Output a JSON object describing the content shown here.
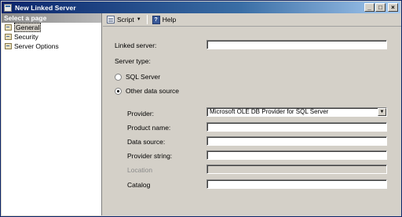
{
  "window": {
    "title": "New Linked Server"
  },
  "title_buttons": {
    "minimize": "_",
    "maximize": "□",
    "close": "×"
  },
  "left_pane": {
    "header": "Select a page",
    "items": [
      {
        "label": "General",
        "icon": "page-wrench-icon",
        "selected": true
      },
      {
        "label": "Security",
        "icon": "page-wrench-icon",
        "selected": false
      },
      {
        "label": "Server Options",
        "icon": "page-wrench-icon",
        "selected": false
      }
    ]
  },
  "toolbar": {
    "script_label": "Script",
    "help_label": "Help",
    "help_glyph": "?"
  },
  "form": {
    "linked_server_label": "Linked server:",
    "linked_server_value": "",
    "server_type_label": "Server type:",
    "sql_server_label": "SQL Server",
    "other_source_label": "Other data source",
    "selected_server_type": "Other data source",
    "provider_label": "Provider:",
    "provider_value": "Microsoft OLE DB Provider for SQL Server",
    "product_name_label": "Product name:",
    "product_name_value": "",
    "data_source_label": "Data source:",
    "data_source_value": "",
    "provider_string_label": "Provider string:",
    "provider_string_value": "",
    "location_label": "Location",
    "location_value": "",
    "catalog_label": "Catalog",
    "catalog_value": ""
  }
}
